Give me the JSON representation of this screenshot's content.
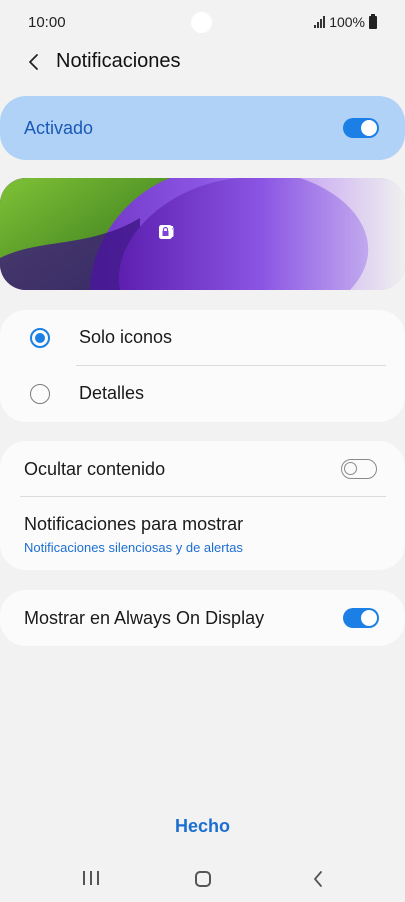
{
  "status_bar": {
    "time": "10:00",
    "battery": "100%"
  },
  "header": {
    "title": "Notificaciones"
  },
  "master": {
    "label": "Activado",
    "enabled": true
  },
  "preview": {
    "icons": [
      "missed-call-icon",
      "message-icon",
      "email-icon",
      "lock-icon"
    ]
  },
  "style_options": {
    "items": [
      {
        "label": "Solo iconos",
        "selected": true
      },
      {
        "label": "Detalles",
        "selected": false
      }
    ]
  },
  "settings": {
    "hide_content_label": "Ocultar contenido",
    "hide_content_enabled": false,
    "notifications_to_show_label": "Notificaciones para mostrar",
    "notifications_to_show_value": "Notificaciones silenciosas y de alertas",
    "aod_label": "Mostrar en Always On Display",
    "aod_enabled": true
  },
  "footer": {
    "done_label": "Hecho"
  },
  "colors": {
    "accent": "#1c7fe5",
    "master_bg": "#b1d2f7",
    "link": "#1c6fd0"
  }
}
